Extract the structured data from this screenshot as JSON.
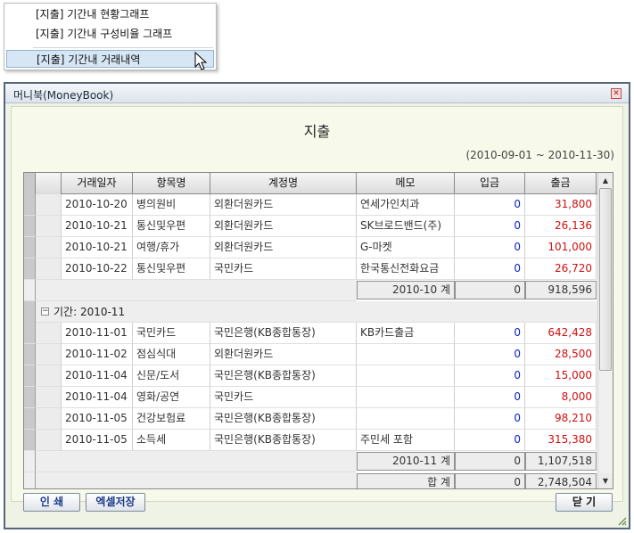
{
  "context_menu": {
    "items": [
      {
        "label": "[지출] 기간내 현황그래프"
      },
      {
        "label": "[지출] 기간내 구성비율 그래프"
      },
      {
        "label": "[지출] 기간내 거래내역"
      }
    ]
  },
  "window": {
    "title": "머니북(MoneyBook)",
    "heading": "지출",
    "date_range": "(2010-09-01 ~ 2010-11-30)"
  },
  "table": {
    "headers": [
      "거래일자",
      "항목명",
      "계정명",
      "메모",
      "입금",
      "출금"
    ],
    "rows_oct": [
      {
        "date": "2010-10-20",
        "item": "병의원비",
        "account": "외환더원카드",
        "memo": "연세가인치과",
        "in": "0",
        "out": "31,800"
      },
      {
        "date": "2010-10-21",
        "item": "통신및우편",
        "account": "외환더원카드",
        "memo": "SK브로드밴드(주)",
        "in": "0",
        "out": "26,136"
      },
      {
        "date": "2010-10-21",
        "item": "여행/휴가",
        "account": "외환더원카드",
        "memo": "G-마켓",
        "in": "0",
        "out": "101,000"
      },
      {
        "date": "2010-10-22",
        "item": "통신및우편",
        "account": "국민카드",
        "memo": "한국통신전화요금",
        "in": "0",
        "out": "26,720"
      }
    ],
    "subtotal_oct": {
      "label": "2010-10 계",
      "in": "0",
      "out": "918,596"
    },
    "group_nov": {
      "label": "기간: 2010-11",
      "toggle": "−"
    },
    "rows_nov": [
      {
        "date": "2010-11-01",
        "item": "국민카드",
        "account": "국민은행(KB종합통장)",
        "memo": "KB카드출금",
        "in": "0",
        "out": "642,428"
      },
      {
        "date": "2010-11-02",
        "item": "점심식대",
        "account": "외환더원카드",
        "memo": "",
        "in": "0",
        "out": "28,500"
      },
      {
        "date": "2010-11-04",
        "item": "신문/도서",
        "account": "국민은행(KB종합통장)",
        "memo": "",
        "in": "0",
        "out": "15,000"
      },
      {
        "date": "2010-11-04",
        "item": "영화/공연",
        "account": "국민카드",
        "memo": "",
        "in": "0",
        "out": "8,000"
      },
      {
        "date": "2010-11-05",
        "item": "건강보험료",
        "account": "국민은행(KB종합통장)",
        "memo": "",
        "in": "0",
        "out": "98,210"
      },
      {
        "date": "2010-11-05",
        "item": "소득세",
        "account": "국민은행(KB종합통장)",
        "memo": "주민세 포함",
        "in": "0",
        "out": "315,380"
      }
    ],
    "subtotal_nov": {
      "label": "2010-11 계",
      "in": "0",
      "out": "1,107,518"
    },
    "total": {
      "label": "합 계",
      "in": "0",
      "out": "2,748,504"
    }
  },
  "buttons": {
    "print": "인 쇄",
    "excel": "엑셀저장",
    "close": "닫 기"
  },
  "colors": {
    "deposit": "#0a23c8",
    "withdrawal": "#d01010"
  }
}
